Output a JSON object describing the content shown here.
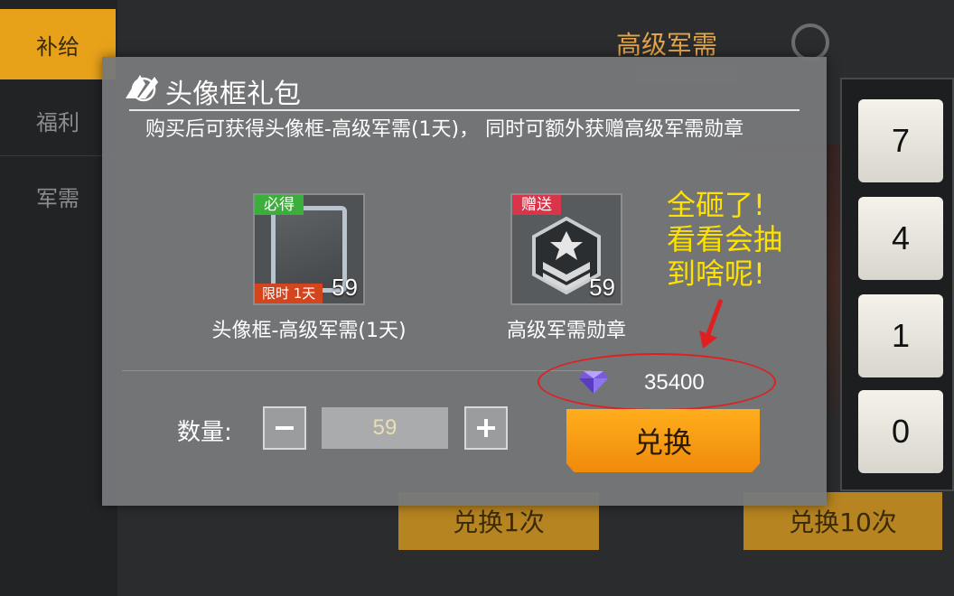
{
  "sidebar": {
    "tabs": [
      {
        "label": "补给",
        "active": true
      },
      {
        "label": "福利",
        "active": false
      },
      {
        "label": "军需",
        "active": false
      }
    ]
  },
  "background": {
    "title": "高级军需",
    "numpad": [
      "7",
      "4",
      "1",
      "0"
    ],
    "redeem_buttons": [
      "兑换1次",
      "兑换10次"
    ]
  },
  "dialog": {
    "title": "头像框礼包",
    "description": "购买后可获得头像框-高级军需(1天)， 同时可额外获赠高级军需勋章",
    "items": [
      {
        "name": "头像框-高级军需(1天)",
        "tag": "必得",
        "sub_tag": "限时 1天",
        "quantity": "59",
        "icon": "avatar-frame-icon"
      },
      {
        "name": "高级军需勋章",
        "tag": "赠送",
        "quantity": "59",
        "icon": "medal-icon"
      }
    ],
    "price": {
      "value": "35400",
      "currency_icon": "diamond-icon"
    },
    "quantity": {
      "label": "数量:",
      "value": "59"
    },
    "exchange_label": "兑换"
  },
  "annotation": {
    "lines": [
      "全砸了!",
      "看看会抽",
      "到啥呢!"
    ]
  },
  "colors": {
    "accent_orange": "#f5970f",
    "tag_green": "#3cae3c",
    "tag_red": "#d8344a",
    "annotation_yellow": "#ffe100",
    "highlight_red": "#e02020"
  }
}
